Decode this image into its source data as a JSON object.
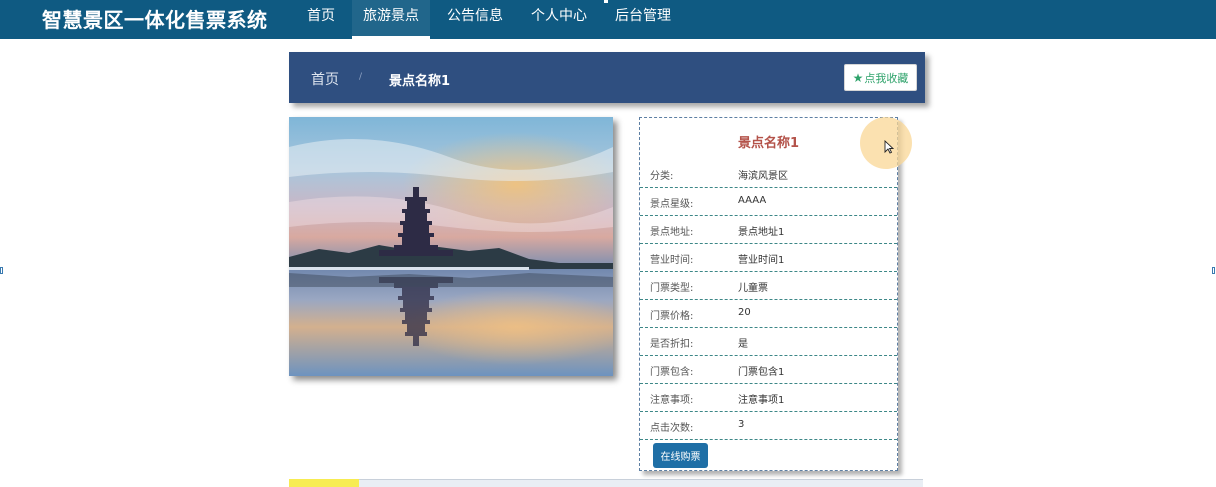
{
  "header": {
    "brand": "智慧景区一体化售票系统",
    "nav": [
      {
        "label": "首页"
      },
      {
        "label": "旅游景点"
      },
      {
        "label": "公告信息"
      },
      {
        "label": "个人中心"
      },
      {
        "label": "后台管理"
      }
    ]
  },
  "breadcrumb": {
    "home": "首页",
    "separator": "/",
    "current": "景点名称1",
    "favorite_label": "点我收藏"
  },
  "detail": {
    "title": "景点名称1",
    "fields": [
      {
        "label": "分类:",
        "value": "海滨风景区"
      },
      {
        "label": "景点星级:",
        "value": "AAAA"
      },
      {
        "label": "景点地址:",
        "value": "景点地址1"
      },
      {
        "label": "营业时间:",
        "value": "营业时间1"
      },
      {
        "label": "门票类型:",
        "value": "儿童票"
      },
      {
        "label": "门票价格:",
        "value": "20"
      },
      {
        "label": "是否折扣:",
        "value": "是"
      },
      {
        "label": "门票包含:",
        "value": "门票包含1"
      },
      {
        "label": "注意事项:",
        "value": "注意事项1"
      },
      {
        "label": "点击次数:",
        "value": "3"
      }
    ],
    "buy_label": "在线购票"
  },
  "colors": {
    "topbar": "#0f5a82",
    "breadcrumb_bg": "#2f4f80",
    "title": "#b4534a",
    "buy_button": "#1f6fa6",
    "favorite_text": "#2fa36b"
  },
  "icons": {
    "favorite": "star-icon",
    "cursor": "mouse-pointer-icon"
  }
}
